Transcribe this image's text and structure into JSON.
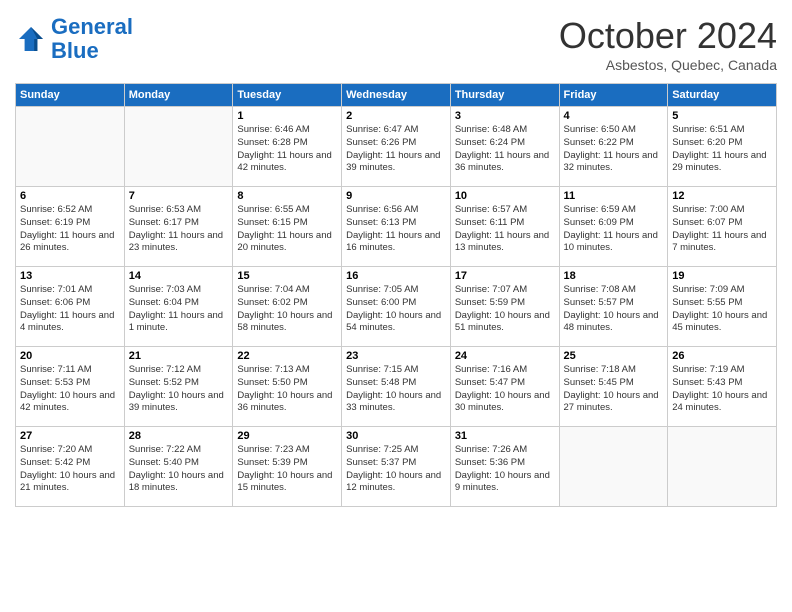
{
  "logo": {
    "line1": "General",
    "line2": "Blue"
  },
  "title": "October 2024",
  "subtitle": "Asbestos, Quebec, Canada",
  "days_of_week": [
    "Sunday",
    "Monday",
    "Tuesday",
    "Wednesday",
    "Thursday",
    "Friday",
    "Saturday"
  ],
  "weeks": [
    [
      {
        "day": "",
        "sunrise": "",
        "sunset": "",
        "daylight": ""
      },
      {
        "day": "",
        "sunrise": "",
        "sunset": "",
        "daylight": ""
      },
      {
        "day": "1",
        "sunrise": "Sunrise: 6:46 AM",
        "sunset": "Sunset: 6:28 PM",
        "daylight": "Daylight: 11 hours and 42 minutes."
      },
      {
        "day": "2",
        "sunrise": "Sunrise: 6:47 AM",
        "sunset": "Sunset: 6:26 PM",
        "daylight": "Daylight: 11 hours and 39 minutes."
      },
      {
        "day": "3",
        "sunrise": "Sunrise: 6:48 AM",
        "sunset": "Sunset: 6:24 PM",
        "daylight": "Daylight: 11 hours and 36 minutes."
      },
      {
        "day": "4",
        "sunrise": "Sunrise: 6:50 AM",
        "sunset": "Sunset: 6:22 PM",
        "daylight": "Daylight: 11 hours and 32 minutes."
      },
      {
        "day": "5",
        "sunrise": "Sunrise: 6:51 AM",
        "sunset": "Sunset: 6:20 PM",
        "daylight": "Daylight: 11 hours and 29 minutes."
      }
    ],
    [
      {
        "day": "6",
        "sunrise": "Sunrise: 6:52 AM",
        "sunset": "Sunset: 6:19 PM",
        "daylight": "Daylight: 11 hours and 26 minutes."
      },
      {
        "day": "7",
        "sunrise": "Sunrise: 6:53 AM",
        "sunset": "Sunset: 6:17 PM",
        "daylight": "Daylight: 11 hours and 23 minutes."
      },
      {
        "day": "8",
        "sunrise": "Sunrise: 6:55 AM",
        "sunset": "Sunset: 6:15 PM",
        "daylight": "Daylight: 11 hours and 20 minutes."
      },
      {
        "day": "9",
        "sunrise": "Sunrise: 6:56 AM",
        "sunset": "Sunset: 6:13 PM",
        "daylight": "Daylight: 11 hours and 16 minutes."
      },
      {
        "day": "10",
        "sunrise": "Sunrise: 6:57 AM",
        "sunset": "Sunset: 6:11 PM",
        "daylight": "Daylight: 11 hours and 13 minutes."
      },
      {
        "day": "11",
        "sunrise": "Sunrise: 6:59 AM",
        "sunset": "Sunset: 6:09 PM",
        "daylight": "Daylight: 11 hours and 10 minutes."
      },
      {
        "day": "12",
        "sunrise": "Sunrise: 7:00 AM",
        "sunset": "Sunset: 6:07 PM",
        "daylight": "Daylight: 11 hours and 7 minutes."
      }
    ],
    [
      {
        "day": "13",
        "sunrise": "Sunrise: 7:01 AM",
        "sunset": "Sunset: 6:06 PM",
        "daylight": "Daylight: 11 hours and 4 minutes."
      },
      {
        "day": "14",
        "sunrise": "Sunrise: 7:03 AM",
        "sunset": "Sunset: 6:04 PM",
        "daylight": "Daylight: 11 hours and 1 minute."
      },
      {
        "day": "15",
        "sunrise": "Sunrise: 7:04 AM",
        "sunset": "Sunset: 6:02 PM",
        "daylight": "Daylight: 10 hours and 58 minutes."
      },
      {
        "day": "16",
        "sunrise": "Sunrise: 7:05 AM",
        "sunset": "Sunset: 6:00 PM",
        "daylight": "Daylight: 10 hours and 54 minutes."
      },
      {
        "day": "17",
        "sunrise": "Sunrise: 7:07 AM",
        "sunset": "Sunset: 5:59 PM",
        "daylight": "Daylight: 10 hours and 51 minutes."
      },
      {
        "day": "18",
        "sunrise": "Sunrise: 7:08 AM",
        "sunset": "Sunset: 5:57 PM",
        "daylight": "Daylight: 10 hours and 48 minutes."
      },
      {
        "day": "19",
        "sunrise": "Sunrise: 7:09 AM",
        "sunset": "Sunset: 5:55 PM",
        "daylight": "Daylight: 10 hours and 45 minutes."
      }
    ],
    [
      {
        "day": "20",
        "sunrise": "Sunrise: 7:11 AM",
        "sunset": "Sunset: 5:53 PM",
        "daylight": "Daylight: 10 hours and 42 minutes."
      },
      {
        "day": "21",
        "sunrise": "Sunrise: 7:12 AM",
        "sunset": "Sunset: 5:52 PM",
        "daylight": "Daylight: 10 hours and 39 minutes."
      },
      {
        "day": "22",
        "sunrise": "Sunrise: 7:13 AM",
        "sunset": "Sunset: 5:50 PM",
        "daylight": "Daylight: 10 hours and 36 minutes."
      },
      {
        "day": "23",
        "sunrise": "Sunrise: 7:15 AM",
        "sunset": "Sunset: 5:48 PM",
        "daylight": "Daylight: 10 hours and 33 minutes."
      },
      {
        "day": "24",
        "sunrise": "Sunrise: 7:16 AM",
        "sunset": "Sunset: 5:47 PM",
        "daylight": "Daylight: 10 hours and 30 minutes."
      },
      {
        "day": "25",
        "sunrise": "Sunrise: 7:18 AM",
        "sunset": "Sunset: 5:45 PM",
        "daylight": "Daylight: 10 hours and 27 minutes."
      },
      {
        "day": "26",
        "sunrise": "Sunrise: 7:19 AM",
        "sunset": "Sunset: 5:43 PM",
        "daylight": "Daylight: 10 hours and 24 minutes."
      }
    ],
    [
      {
        "day": "27",
        "sunrise": "Sunrise: 7:20 AM",
        "sunset": "Sunset: 5:42 PM",
        "daylight": "Daylight: 10 hours and 21 minutes."
      },
      {
        "day": "28",
        "sunrise": "Sunrise: 7:22 AM",
        "sunset": "Sunset: 5:40 PM",
        "daylight": "Daylight: 10 hours and 18 minutes."
      },
      {
        "day": "29",
        "sunrise": "Sunrise: 7:23 AM",
        "sunset": "Sunset: 5:39 PM",
        "daylight": "Daylight: 10 hours and 15 minutes."
      },
      {
        "day": "30",
        "sunrise": "Sunrise: 7:25 AM",
        "sunset": "Sunset: 5:37 PM",
        "daylight": "Daylight: 10 hours and 12 minutes."
      },
      {
        "day": "31",
        "sunrise": "Sunrise: 7:26 AM",
        "sunset": "Sunset: 5:36 PM",
        "daylight": "Daylight: 10 hours and 9 minutes."
      },
      {
        "day": "",
        "sunrise": "",
        "sunset": "",
        "daylight": ""
      },
      {
        "day": "",
        "sunrise": "",
        "sunset": "",
        "daylight": ""
      }
    ]
  ]
}
